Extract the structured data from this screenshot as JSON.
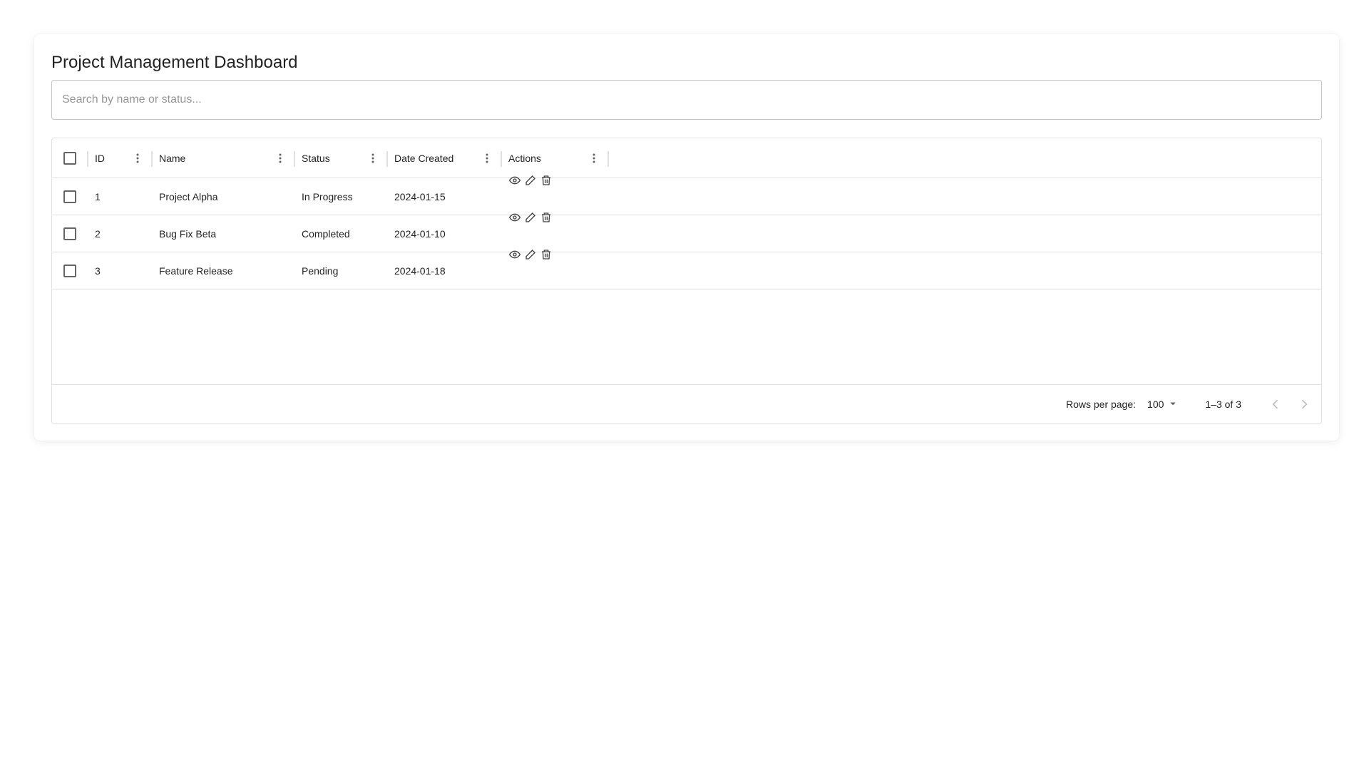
{
  "page": {
    "title": "Project Management Dashboard"
  },
  "search": {
    "placeholder": "Search by name or status...",
    "value": ""
  },
  "columns": {
    "id": "ID",
    "name": "Name",
    "status": "Status",
    "date": "Date Created",
    "actions": "Actions"
  },
  "rows": [
    {
      "id": "1",
      "name": "Project Alpha",
      "status": "In Progress",
      "date": "2024-01-15"
    },
    {
      "id": "2",
      "name": "Bug Fix Beta",
      "status": "Completed",
      "date": "2024-01-10"
    },
    {
      "id": "3",
      "name": "Feature Release",
      "status": "Pending",
      "date": "2024-01-18"
    }
  ],
  "row_actions": [
    "eye-icon",
    "pencil-icon",
    "trash-icon"
  ],
  "footer": {
    "rows_per_page_label": "Rows per page:",
    "rows_per_page_value": "100",
    "range_label": "1–3 of 3"
  },
  "colors": {
    "border": "#e0e0e0",
    "text": "#212121",
    "icon": "#616161",
    "disabled": "#bdbdbd"
  }
}
